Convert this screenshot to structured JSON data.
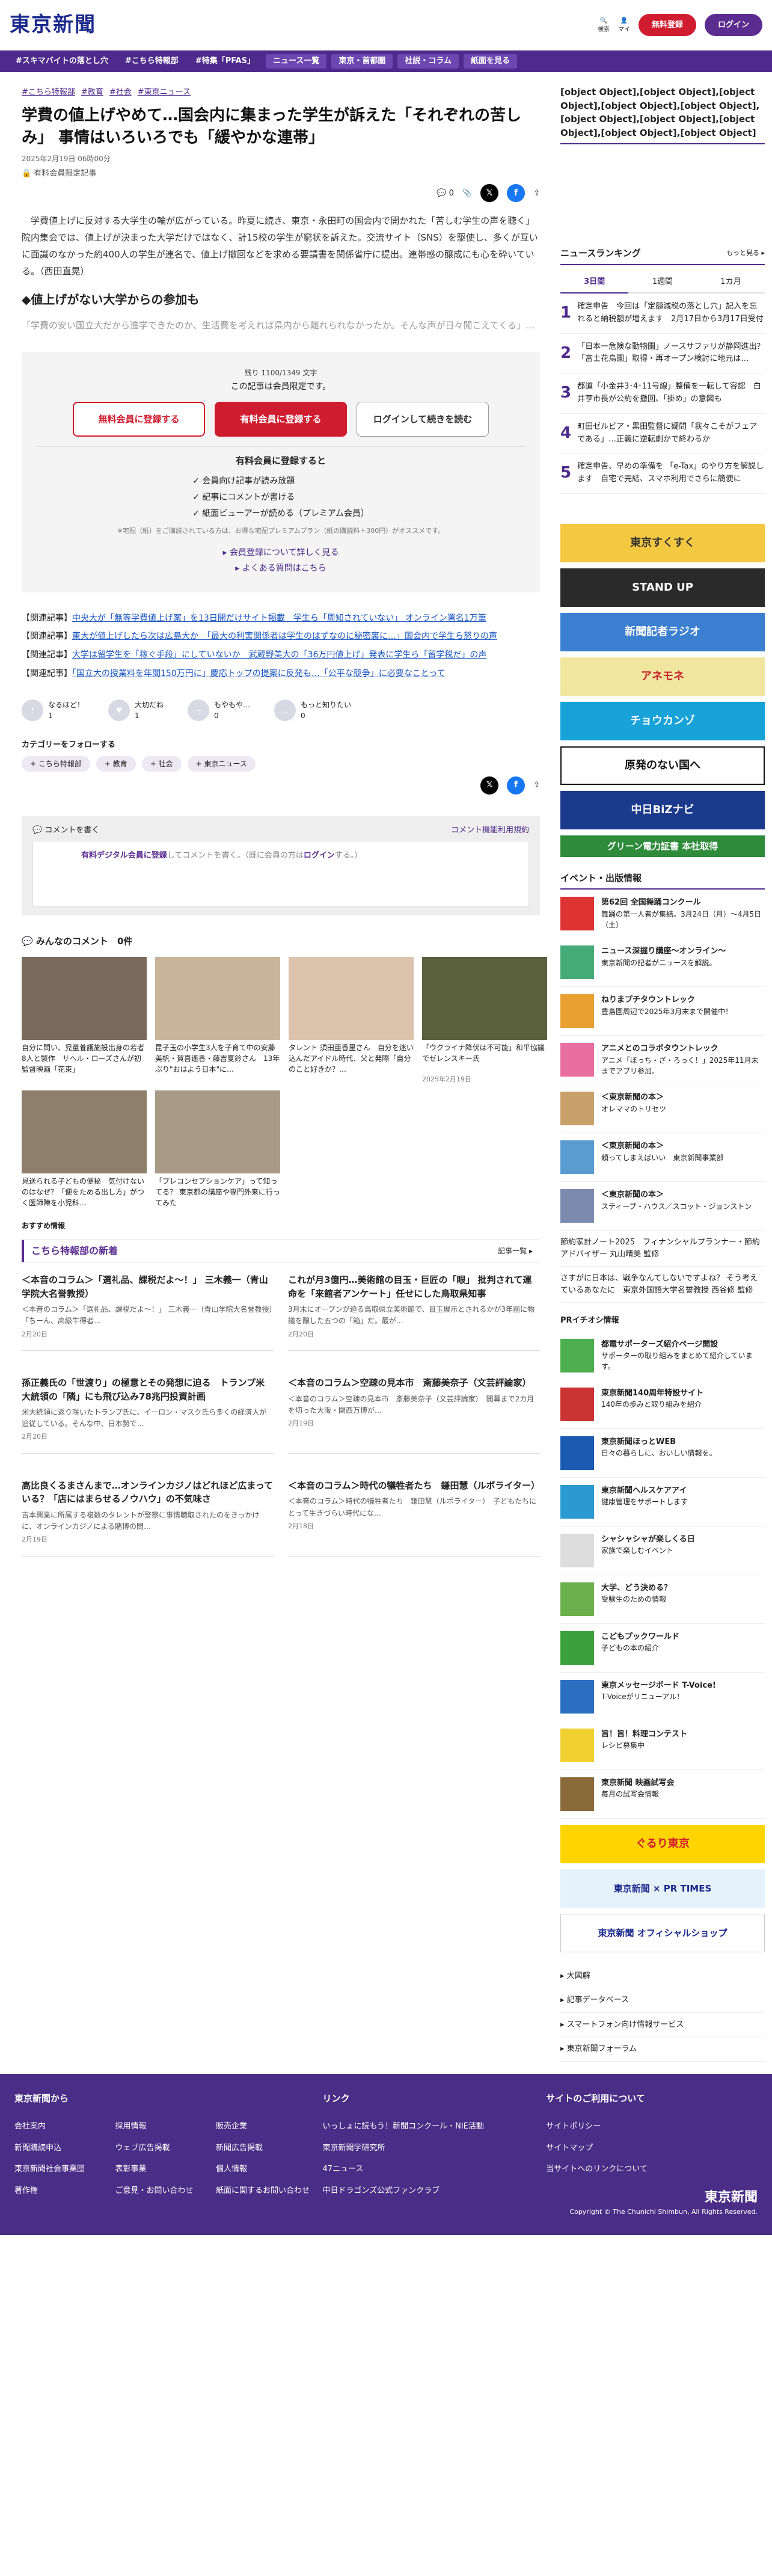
{
  "header": {
    "logo": "東京新聞",
    "search": "検索",
    "mypage": "マイ",
    "free": "無料登録",
    "login": "ログイン"
  },
  "nav": [
    "#スキマバイトの落とし穴",
    "#こちら特報部",
    "#特集「PFAS」",
    "ニュース一覧",
    "東京・首都圏",
    "社説・コラム",
    "紙面を見る"
  ],
  "article": {
    "tags": [
      "#こちら特報部",
      "#教育",
      "#社会",
      "#東京ニュース"
    ],
    "title": "学費の値上げやめて…国会内に集まった学生が訴えた「それぞれの苦しみ」 事情はいろいろでも「緩やかな連帯」",
    "date": "2025年2月19日 06時00分",
    "paid": "有料会員限定記事",
    "comments": "0",
    "p1": "学費値上げに反対する大学生の輪が広がっている。昨夏に続き、東京・永田町の国会内で開かれた「苦しむ学生の声を聴く」院内集会では、値上げが決まった大学だけではなく、計15校の学生が窮状を訴えた。交流サイト（SNS）を駆使し、多くが互いに面識のなかった約400人の学生が連名で、値上げ撤回などを求める要請書を関係省庁に提出。連帯感の醸成にも心を砕いている。（西田直晃）",
    "h2": "◆値上げがない大学からの参加も",
    "p2": "「学費の安い国立大だから進学できたのか、生活費を考えれば県内から離れられなかったか。そんな声が日々聞こえてくる」…"
  },
  "paywall": {
    "count": "残り 1100/1349 文字",
    "msg": "この記事は会員限定です。",
    "b1": "無料会員に登録する",
    "b2": "有料会員に登録する",
    "b3": "ログインして続きを読む",
    "h": "有料会員に登録すると",
    "list": [
      "✓ 会員向け記事が読み放題",
      "✓ 記事にコメントが書ける",
      "✓ 紙面ビューアーが読める（プレミアム会員）"
    ],
    "note": "※宅配（紙）をご購読されている方は、お得な宅配プレミアムプラン（紙の購読料＋300円）がオススメです。",
    "l1": "▸ 会員登録について詳しく見る",
    "l2": "▸ よくある質問はこちら"
  },
  "related": [
    {
      "k": "【関連記事】",
      "t": "中央大が「無等学費値上げ案」を13日開だけサイト掲載　学生ら「周知されていない」 オンライン署名1万筆"
    },
    {
      "k": "【関連記事】",
      "t": "東大が値上げしたら次は広島大か　「最大の利害関係者は学生のはずなのに秘密裏に…」国会内で学生ら怒りの声"
    },
    {
      "k": "【関連記事】",
      "t": "大学は留学生を「稼ぐ手段」にしていないか　武蔵野美大の「36万円値上げ」発表に学生ら「留学税だ」の声"
    },
    {
      "k": "【関連記事】",
      "t": "「国立大の授業料を年間150万円に」慶応トップの提案に反発も…「公平な競争」に必要なことって"
    }
  ],
  "reactions": [
    {
      "l": "なるほど！",
      "c": "1"
    },
    {
      "l": "大切だね",
      "c": "1"
    },
    {
      "l": "もやもや…",
      "c": "0"
    },
    {
      "l": "もっと知りたい",
      "c": "0"
    }
  ],
  "follow": {
    "h": "カテゴリーをフォローする",
    "chips": [
      "+ こちら特報部",
      "+ 教育",
      "+ 社会",
      "+ 東京ニュース"
    ]
  },
  "commentbox": {
    "title": "コメントを書く",
    "rule": "コメント機能利用規約",
    "text1": "有料デジタル会員に登録",
    "text2": "してコメントを書く。（既に会員の方は",
    "text3": "ログイン",
    "text4": "する。）"
  },
  "allcomments": {
    "h": "みんなのコメント",
    "c": "0件"
  },
  "photos": [
    {
      "t": "自分に問い、児童養護施設出身の若者8人と製作　サヘル・ローズさんが初監督映画「花束」",
      "d": ""
    },
    {
      "t": "昆子玉の小学生3人を子育て中の安藤美帆・賀喜遥香・藤吉夏鈴さん　13年ぶり\"おはよう日本\"に…",
      "d": ""
    },
    {
      "t": "タレント 須田亜香里さん　自分を迷い込んだアイドル時代、父と発際「自分のこと好きか？…",
      "d": ""
    },
    {
      "t": "「ウクライナ降伏は不可能」和平協議でゼレンスキー氏",
      "d": "2025年2月19日"
    },
    {
      "t": "見送られる子どもの便秘　気付けないのはなぜ？「便をためる出し方」がつく医師陣を小児科…",
      "d": ""
    },
    {
      "t": "「プレコンセプションケア」って知ってる？ 東京都の講座や専門外来に行ってみた",
      "d": ""
    }
  ],
  "osusume": "おすすめ情報",
  "series": {
    "title": "こちら特報部の新着",
    "more": "記事一覧 ▸"
  },
  "news": [
    {
      "h": "＜本音のコラム＞「選礼品、課税だよ～！」 三木義一（青山学院大名誉教授）",
      "p": "＜本音のコラム＞「選礼品、課税だよ～！」 三木義一（青山学院大名誉教授）　「ちーん、高級牛得者…",
      "d": "2月20日"
    },
    {
      "h": "これが月3億円…美術館の目玉・巨匠の「眼」 批判されて運命を「来館者アンケート」任せにした鳥取県知事",
      "p": "3月末にオープンが迫る鳥取県立美術館で、目玉展示とされるかが3年前に物議を醸した五つの「箱」だ。最が…",
      "d": "2月20日"
    },
    {
      "h": "孫正義氏の「世渡り」の極意とその発想に迫る　トランプ米大統領の「隣」にも飛び込み78兆円投資計画",
      "p": "米大統領に返り咲いたトランプ氏に、イーロン・マスク氏ら多くの経済人が追従している。そんな中、日本勢で…",
      "d": "2月20日"
    },
    {
      "h": "＜本音のコラム＞空疎の見本市　斎藤美奈子（文芸評論家）",
      "p": "＜本音のコラム＞空疎の見本市　斎藤美奈子（文芸評論家）　開幕まで2カ月を切った大阪・関西万博が…",
      "d": "2月19日"
    },
    {
      "h": "高比良くるまさんまで…オンラインカジノはどれほど広まっている？「店にはまらせるノウハウ」の不気味さ",
      "p": "吉本興業に所属する複数のタレントが警察に事情聴取されたのをきっかけに、オンラインカジノによる賭博の問…",
      "d": "2月19日"
    },
    {
      "h": "＜本音のコラム＞時代の犠牲者たち　鎌田慧（ルポライター）",
      "p": "＜本音のコラム＞時代の犠牲者たち　鎌田慧（ルポライター）　子どもたちにとって生きづらい時代にな…",
      "d": "2月18日"
    }
  ],
  "side": {
    "pr": [
      {
        "b": "都電サポーターズ紹介ページ開設",
        "t": "サポーターの取り組みをまとめて紹介しています。"
      },
      {
        "b": "東京新聞140周年特設サイト",
        "t": "140年の歩みと取り組みを紹介"
      },
      {
        "b": "東京新聞ほっとWEB",
        "t": "日々の暮らしに、おいしい情報を。"
      },
      {
        "b": "東京新聞ヘルスケアアイ",
        "t": "健康管理をサポートします"
      },
      {
        "b": "シャシャシャが楽しくる日",
        "t": "家族で楽しむイベント"
      },
      {
        "b": "大学、どう決める？",
        "t": "受験生のための情報"
      },
      {
        "b": "こどもプックワールド",
        "t": "子どもの本の紹介"
      },
      {
        "b": "東京メッセージボード T-Voice!",
        "t": "T-Voiceがリニューアル！"
      },
      {
        "b": "旨！旨！料理コンテスト",
        "t": "レシピ募集中"
      },
      {
        "b": "東京新聞 映画試写会",
        "t": "毎月の試写会情報"
      }
    ],
    "rank_h": "ニュースランキング",
    "rank_more": "もっと見る ▸",
    "tabs": [
      "3日間",
      "1週間",
      "1カ月"
    ],
    "rank": [
      "確定申告　今回は「定額減税の落とし穴」記入を忘れると納税額が増えます　2月17日から3月17日受付",
      "「日本一危険な動物園」ノースサファリが静岡進出？「富士花鳥園」取得・再オープン検討に地元は…",
      "都道「小金井3･4･11号線」整備を一転して容認　白井亨市長が公約を撤回、「掛め」の意図も",
      "町田ゼルビア・黒田監督に疑問「我々こそがフェアである」…正義に逆転劇かで終わるか",
      "確定申告、早めの準備を 「e-Tax」のやり方を解説します　自宅で完結、スマホ利用でさらに簡便に"
    ],
    "banners": [
      "東京すくすく",
      "STAND UP",
      "新聞記者ラジオ",
      "アネモネ",
      "チョウカンゾ",
      "原発のない国へ",
      "中日BiZナビ",
      "グリーン電力証書 本社取得"
    ],
    "ev_h": "イベント・出版情報",
    "events": [
      {
        "b": "第62回 全国舞踊コンクール",
        "t": "舞踊の第一人者が集結。3月24日（月）～4月5日（土）"
      },
      {
        "b": "ニュース深掘り講座～オンライン～",
        "t": "東京新聞の記者がニュースを解説。"
      },
      {
        "b": "ねりまプチタウントレック",
        "t": "豊島園周辺で2025年3月末まで開催中！"
      },
      {
        "b": "アニメとのコラボタウントレック",
        "t": "アニメ「ぼっち・ざ・ろっく！」2025年11月末までアプリ参加。"
      },
      {
        "b": "＜東京新聞の本＞",
        "t": "オレママのトリセツ"
      },
      {
        "b": "＜東京新聞の本＞",
        "t": "頼ってしまえばいい　東京新聞事業部"
      },
      {
        "b": "＜東京新聞の本＞",
        "t": "スティーブ・ハウス／スコット・ジョンストン"
      }
    ],
    "ev_extra": [
      "節約家計ノート2025　フィナンシャルプランナー・節約アドバイザー 丸山晴美 監修",
      "さすがに日本は、戦争なんてしないですよね？ そう考えているあなたに　東京外国語大学名誉教授 西谷修 監修"
    ],
    "pr_h": "PRイチオシ情報",
    "sbanners": [
      "ぐるり東京",
      "東京新聞 × PR TIMES",
      "東京新聞 オフィシャルショップ"
    ],
    "flinks": [
      "▸ 大図解",
      "▸ 記事データベース",
      "▸ スマートフォン向け情報サービス",
      "▸ 東京新聞フォーラム"
    ]
  },
  "footer": {
    "c1": "東京新聞から",
    "c2": "リンク",
    "c3": "サイトのご利用について",
    "g1": [
      "会社案内",
      "採用情報",
      "販売企業",
      "新聞購読申込",
      "ウェブ広告掲載",
      "新聞広告掲載",
      "東京新聞社会事業団",
      "表彰事業",
      "個人情報",
      "著作権",
      "ご意見・お問い合わせ",
      "紙面に関するお問い合わせ"
    ],
    "g2": [
      "いっしょに読もう！新聞コンクール・NIE活動",
      "東京新聞学研究所",
      "47ニュース",
      "中日ドラゴンズ公式ファンクラブ"
    ],
    "g3": [
      "サイトポリシー",
      "サイトマップ",
      "当サイトへのリンクについて"
    ],
    "copy": "Copyright © The Chunichi Shimbun, All Rights Reserved.",
    "logo": "東京新聞"
  }
}
